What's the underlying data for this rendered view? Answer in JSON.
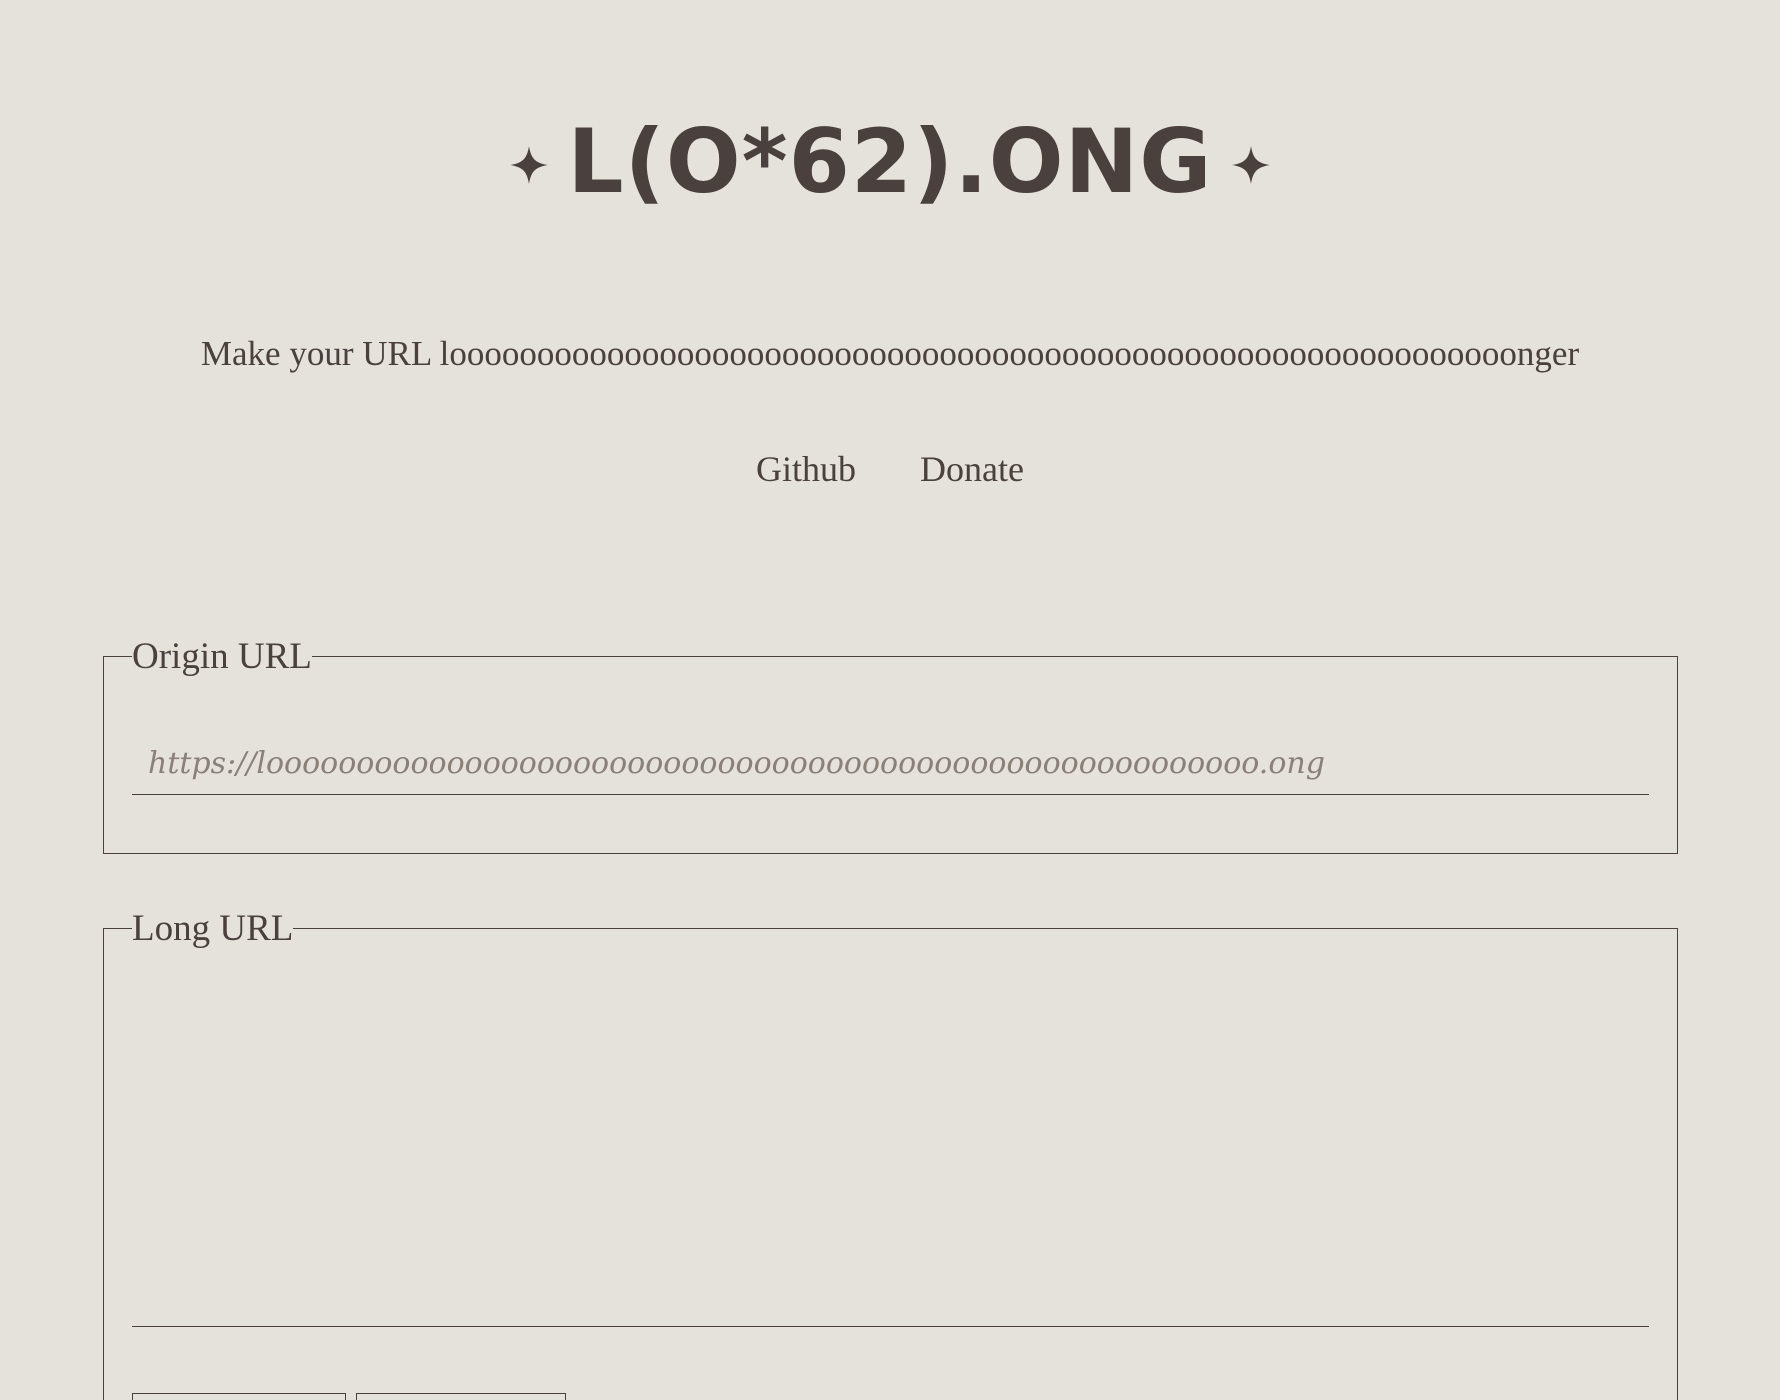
{
  "header": {
    "logo_text": "L(O*62).ONG",
    "left_icon": "sparkle-icon",
    "right_icon": "sparkle-icon"
  },
  "tagline": "Make your URL looooooooooooooooooooooooooooooooooooooooooooooooooooooooooooonger",
  "nav": {
    "github": "Github",
    "donate": "Donate"
  },
  "origin": {
    "legend": "Origin URL",
    "placeholder": "https://looooooooooooooooooooooooooooooooooooooooooooooooooooooo.ong",
    "value": ""
  },
  "long": {
    "legend": "Long URL",
    "value": ""
  },
  "colors": {
    "background": "#e5e2dc",
    "text": "#4a403d",
    "placeholder": "#8a7f79"
  }
}
